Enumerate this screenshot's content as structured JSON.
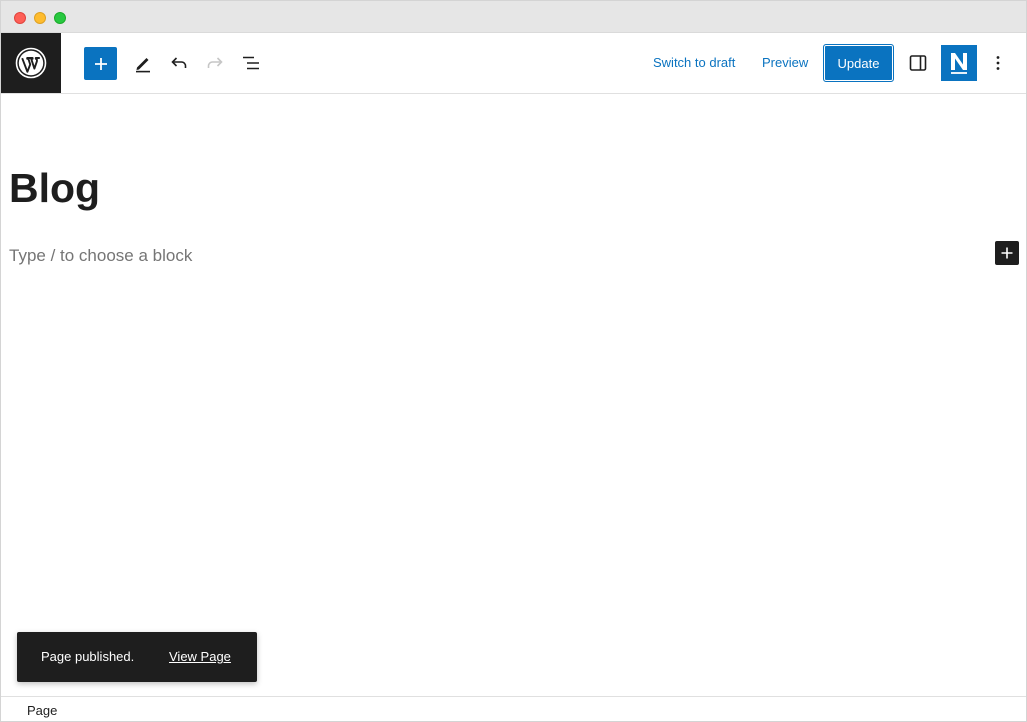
{
  "window": {
    "controls": [
      "close",
      "minimize",
      "maximize"
    ]
  },
  "header": {
    "logo_icon": "wordpress-logo-icon",
    "tools": [
      {
        "icon": "plus-icon",
        "label": "Add block"
      },
      {
        "icon": "pencil-icon",
        "label": "Tools"
      },
      {
        "icon": "undo-icon",
        "label": "Undo"
      },
      {
        "icon": "redo-icon",
        "label": "Redo"
      },
      {
        "icon": "list-view-icon",
        "label": "List view"
      }
    ],
    "switch_to_draft": "Switch to draft",
    "preview": "Preview",
    "update": "Update",
    "settings_icon": "sidebar-toggle-icon",
    "plugin_icon": "n-plugin-icon",
    "options_icon": "vertical-ellipsis-icon"
  },
  "content": {
    "title": "Blog",
    "placeholder": "Type / to choose a block",
    "add_block_icon": "plus-icon"
  },
  "snackbar": {
    "message": "Page published.",
    "action": "View Page"
  },
  "footer": {
    "breadcrumb": "Page"
  },
  "colors": {
    "accent": "#0a73c0",
    "dark": "#1e1e1e",
    "placeholder": "#757575"
  }
}
